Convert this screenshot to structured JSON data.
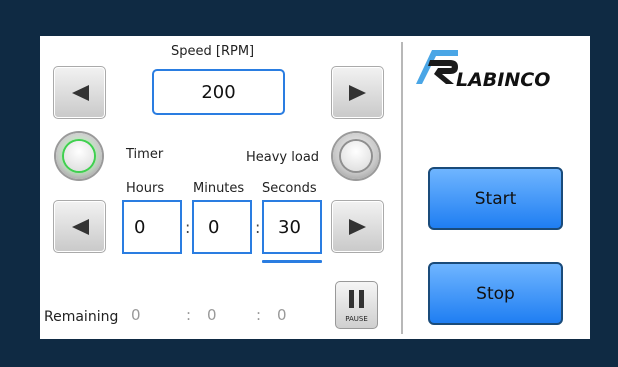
{
  "speed": {
    "label": "Speed [RPM]",
    "value": "200"
  },
  "timer": {
    "label": "Timer",
    "heavy_load_label": "Heavy load",
    "hours_label": "Hours",
    "minutes_label": "Minutes",
    "seconds_label": "Seconds",
    "hours": "0",
    "minutes": "0",
    "seconds": "30",
    "separator": ":"
  },
  "remaining": {
    "label": "Remaining",
    "hours": "0",
    "minutes": "0",
    "seconds": "0",
    "separator": ":"
  },
  "pause": {
    "label": "PAUSE"
  },
  "logo": {
    "text": "LABINCO"
  },
  "actions": {
    "start_label": "Start",
    "stop_label": "Stop"
  },
  "colors": {
    "background": "#0f2a43",
    "accent": "#2a7de1",
    "button_blue": "#1f7ef2",
    "timer_indicator": "#3fd04f"
  }
}
